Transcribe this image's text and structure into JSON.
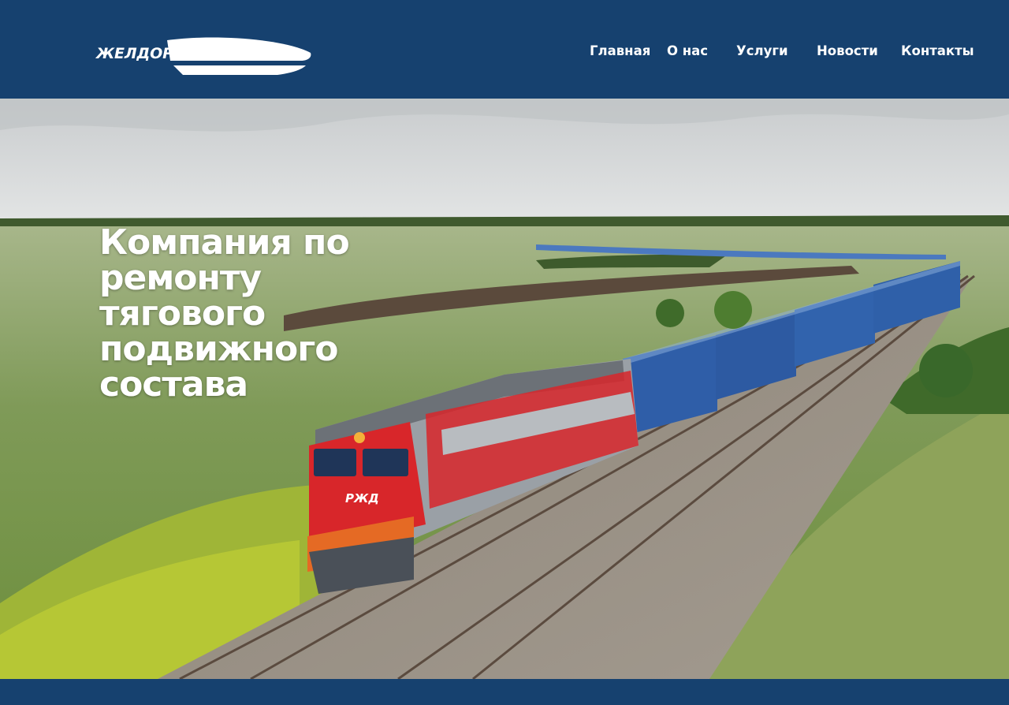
{
  "brand": {
    "logo_text": "ЖЕЛДОРРЕММАШ"
  },
  "nav": {
    "items": [
      {
        "label": "Главная"
      },
      {
        "label": "О нас"
      },
      {
        "label": "Услуги"
      },
      {
        "label": "Новости"
      },
      {
        "label": "Контакты"
      }
    ]
  },
  "hero": {
    "title": "Компания по ремонту тягового подвижного состава",
    "locomotive_marking": "РЖД"
  },
  "colors": {
    "header_bg": "#16416f",
    "text": "#ffffff",
    "locomotive_red": "#d8262a",
    "container_blue": "#2f5ea8",
    "grass_green": "#7a9a45"
  }
}
